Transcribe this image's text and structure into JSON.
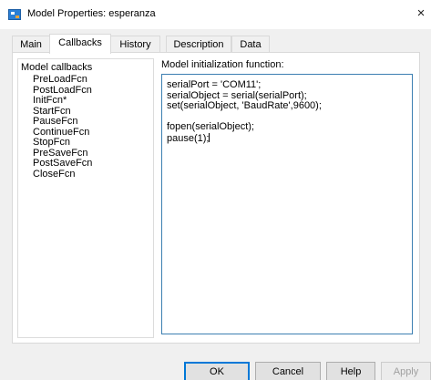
{
  "window": {
    "title": "Model Properties: esperanza",
    "close_glyph": "×",
    "icon": "simulink-model-icon"
  },
  "tabs": [
    {
      "label": "Main"
    },
    {
      "label": "Callbacks"
    },
    {
      "label": "History"
    },
    {
      "label": "Description"
    },
    {
      "label": "Data"
    }
  ],
  "active_tab": "Callbacks",
  "callbacks": {
    "header": "Model callbacks",
    "items": [
      "PreLoadFcn",
      "PostLoadFcn",
      "InitFcn*",
      "StartFcn",
      "PauseFcn",
      "ContinueFcn",
      "StopFcn",
      "PreSaveFcn",
      "PostSaveFcn",
      "CloseFcn"
    ],
    "selected": "InitFcn*"
  },
  "editor": {
    "label": "Model initialization function:",
    "lines": [
      "serialPort = 'COM11';",
      "serialObject = serial(serialPort);",
      "set(serialObject, 'BaudRate',9600);",
      "",
      "fopen(serialObject);",
      "pause(1);"
    ]
  },
  "buttons": {
    "ok": "OK",
    "cancel": "Cancel",
    "help": "Help",
    "apply": "Apply"
  }
}
